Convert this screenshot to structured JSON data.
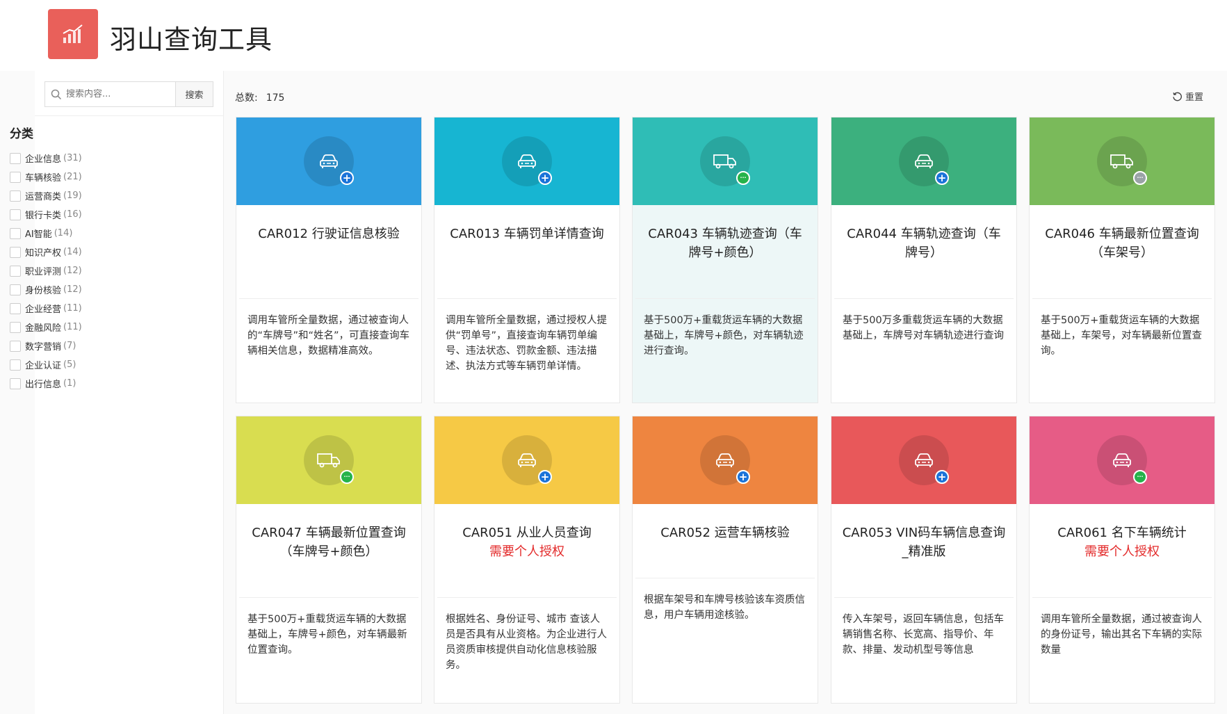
{
  "app": {
    "title": "羽山查询工具"
  },
  "search": {
    "placeholder": "搜索内容...",
    "button": "搜索"
  },
  "sidebar": {
    "category_title": "分类",
    "categories": [
      {
        "label": "企业信息",
        "count": "(31)"
      },
      {
        "label": "车辆核验",
        "count": "(21)"
      },
      {
        "label": "运营商类",
        "count": "(19)"
      },
      {
        "label": "银行卡类",
        "count": "(16)"
      },
      {
        "label": "AI智能",
        "count": "(14)"
      },
      {
        "label": "知识产权",
        "count": "(14)"
      },
      {
        "label": "职业评测",
        "count": "(12)"
      },
      {
        "label": "身份核验",
        "count": "(12)"
      },
      {
        "label": "企业经营",
        "count": "(11)"
      },
      {
        "label": "金融风险",
        "count": "(11)"
      },
      {
        "label": "数字营销",
        "count": "(7)"
      },
      {
        "label": "企业认证",
        "count": "(5)"
      },
      {
        "label": "出行信息",
        "count": "(1)"
      }
    ]
  },
  "main": {
    "total_label": "总数:",
    "total_value": "175",
    "reset_label": "重置",
    "cards": [
      {
        "title": "CAR012 行驶证信息核验",
        "auth": "",
        "desc": "调用车管所全量数据，通过被查询人的“车牌号”和“姓名”，可直接查询车辆相关信息，数据精准高效。",
        "color": "#2f9ee0",
        "icon": "car-icon",
        "badge": "blue"
      },
      {
        "title": "CAR013 车辆罚单详情查询",
        "auth": "",
        "desc": "调用车管所全量数据，通过授权人提供“罚单号”，直接查询车辆罚单编号、违法状态、罚款金额、违法描述、执法方式等车辆罚单详情。",
        "color": "#17b5d2",
        "icon": "car-icon",
        "badge": "blue"
      },
      {
        "title": "CAR043 车辆轨迹查询（车牌号+颜色）",
        "auth": "",
        "desc": "基于500万+重载货运车辆的大数据基础上，车牌号+颜色，对车辆轨迹进行查询。",
        "color": "#2fbdb6",
        "icon": "truck-icon",
        "badge": "green"
      },
      {
        "title": "CAR044 车辆轨迹查询（车牌号）",
        "auth": "",
        "desc": "基于500万多重载货运车辆的大数据基础上，车牌号对车辆轨迹进行查询",
        "color": "#3cb07e",
        "icon": "car-icon",
        "badge": "blue"
      },
      {
        "title": "CAR046 车辆最新位置查询（车架号）",
        "auth": "",
        "desc": "基于500万+重载货运车辆的大数据基础上，车架号，对车辆最新位置查询。",
        "color": "#7aba5a",
        "icon": "truck-icon",
        "badge": "grey"
      },
      {
        "title": "CAR047 车辆最新位置查询（车牌号+颜色）",
        "auth": "",
        "desc": "基于500万+重载货运车辆的大数据基础上，车牌号+颜色，对车辆最新位置查询。",
        "color": "#d9dd50",
        "icon": "truck-icon",
        "badge": "green"
      },
      {
        "title": "CAR051 从业人员查询",
        "auth": "需要个人授权",
        "desc": "根据姓名、身份证号、城市 查该人员是否具有从业资格。为企业进行人员资质审核提供自动化信息核验服务。",
        "color": "#f6c945",
        "icon": "car-icon",
        "badge": "blue"
      },
      {
        "title": "CAR052 运营车辆核验",
        "auth": "",
        "desc": "根据车架号和车牌号核验该车资质信息，用户车辆用途核验。",
        "color": "#ee8540",
        "icon": "car-icon",
        "badge": "blue"
      },
      {
        "title": "CAR053 VIN码车辆信息查询_精准版",
        "auth": "",
        "desc": "传入车架号，返回车辆信息，包括车辆销售名称、长宽高、指导价、年款、排量、发动机型号等信息",
        "color": "#e8585a",
        "icon": "car-icon",
        "badge": "blue"
      },
      {
        "title": "CAR061 名下车辆统计",
        "auth": "需要个人授权",
        "desc": "调用车管所全量数据，通过被查询人的身份证号，输出其名下车辆的实际数量",
        "color": "#e65c86",
        "icon": "car-icon",
        "badge": "green"
      }
    ]
  }
}
